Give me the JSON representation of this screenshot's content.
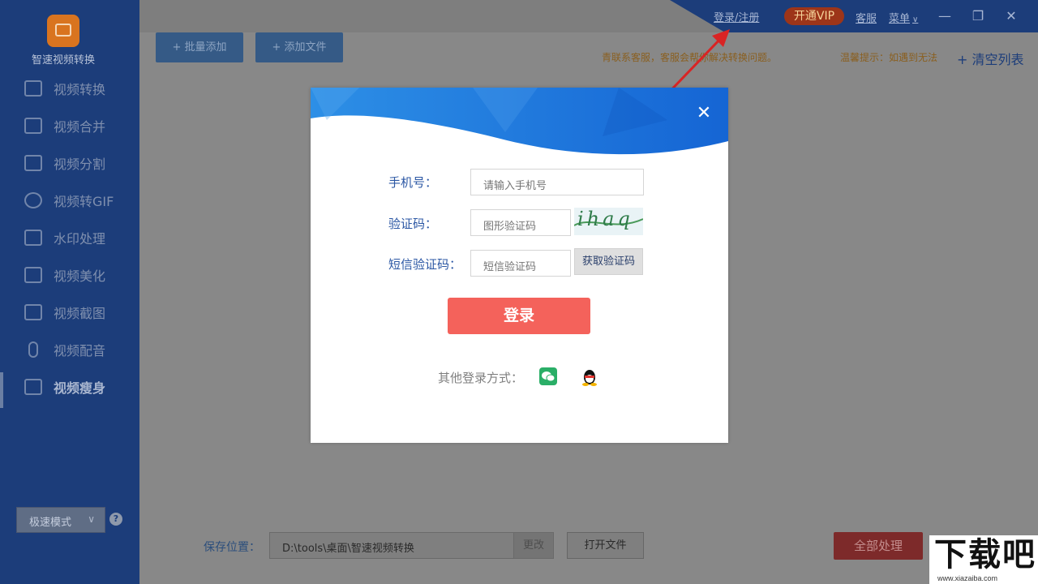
{
  "app": {
    "name": "智速视频转换"
  },
  "sidebar": {
    "items": [
      {
        "label": "视频转换",
        "icon": "video-camera-icon"
      },
      {
        "label": "视频合并",
        "icon": "merge-icon"
      },
      {
        "label": "视频分割",
        "icon": "split-icon"
      },
      {
        "label": "视频转GIF",
        "icon": "convert-arrows-icon"
      },
      {
        "label": "水印处理",
        "icon": "watermark-icon"
      },
      {
        "label": "视频美化",
        "icon": "magic-wand-icon"
      },
      {
        "label": "视频截图",
        "icon": "image-icon"
      },
      {
        "label": "视频配音",
        "icon": "microphone-icon"
      },
      {
        "label": "视频瘦身",
        "icon": "compress-icon"
      }
    ],
    "active_index": 8,
    "speed_mode": "极速模式",
    "help": "?"
  },
  "topbar": {
    "login_register": "登录/注册",
    "vip": "开通VIP",
    "customer_service": "客服",
    "menu": "菜单",
    "minimize": "—",
    "restore": "❐",
    "close": "✕"
  },
  "toolbar": {
    "batch_add": "+ 批量添加",
    "add_file": "+ 添加文件",
    "notice": "青联系客服，客服会帮你解决转换问题。",
    "tip": "温馨提示：如遇到无法",
    "clear_list": "+ 清空列表"
  },
  "bottom": {
    "save_label": "保存位置：",
    "save_path": "D:\\tools\\桌面\\智速视频转换",
    "change": "更改",
    "open_file": "打开文件",
    "process_all": "全部处理"
  },
  "dialog": {
    "close": "✕",
    "phone_label": "手机号：",
    "phone_placeholder": "请输入手机号",
    "captcha_label": "验证码：",
    "captcha_placeholder": "图形验证码",
    "captcha_text": "ihaq",
    "sms_label": "短信验证码：",
    "sms_placeholder": "短信验证码",
    "get_code": "获取验证码",
    "login": "登录",
    "other_login": "其他登录方式："
  },
  "watermark": {
    "title": "下载吧",
    "url": "www.xiazaiba.com"
  },
  "colors": {
    "sidebar_bg": "#1c3d7a",
    "accent_blue": "#2b57a4",
    "login_red": "#f4625b",
    "vip_bg": "#9d3519",
    "annotation_arrow": "#d92424"
  }
}
